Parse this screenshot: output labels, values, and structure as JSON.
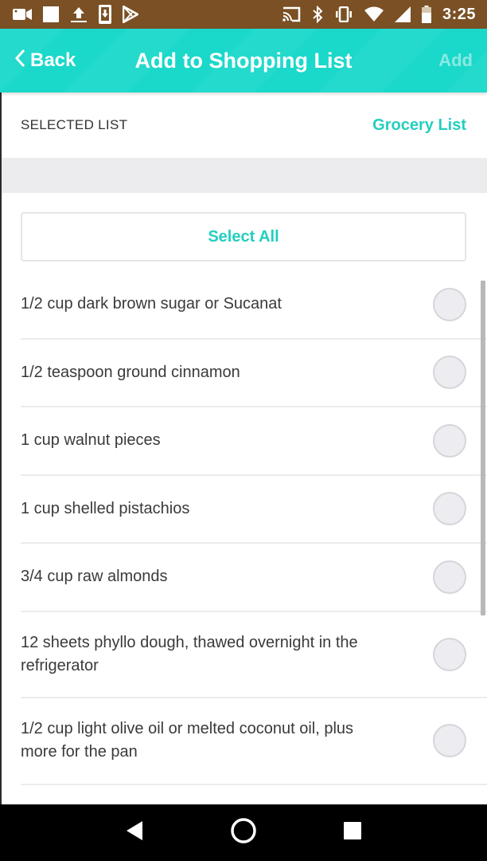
{
  "status_bar": {
    "left_icons": [
      "video-camera-icon",
      "square-notification-icon",
      "upload-icon",
      "download-to-phone-icon",
      "play-store-icon"
    ],
    "right_icons": [
      "cast-icon",
      "bluetooth-icon",
      "vibrate-icon",
      "wifi-icon",
      "cellular-signal-icon",
      "battery-icon"
    ],
    "time": "3:25"
  },
  "app_bar": {
    "back_label": "Back",
    "title": "Add to Shopping List",
    "add_label": "Add",
    "colors": {
      "background": "#1ad8ca",
      "add_disabled": "#8ae9e2"
    }
  },
  "selected_list": {
    "label": "SELECTED LIST",
    "value": "Grocery List"
  },
  "select_all_label": "Select All",
  "accent_color": "#23cfbf",
  "ingredients": [
    {
      "text": "1/2 cup dark brown sugar or Sucanat",
      "checked": false
    },
    {
      "text": "1/2 teaspoon ground cinnamon",
      "checked": false
    },
    {
      "text": "1 cup walnut pieces",
      "checked": false
    },
    {
      "text": "1 cup shelled pistachios",
      "checked": false
    },
    {
      "text": "3/4 cup raw almonds",
      "checked": false
    },
    {
      "text": "12 sheets phyllo dough, thawed overnight in the refrigerator",
      "checked": false
    },
    {
      "text": "1/2 cup light olive oil or melted coconut oil, plus more for the pan",
      "checked": false
    }
  ],
  "nav_bar": {
    "buttons": [
      "back-triangle-icon",
      "home-circle-icon",
      "recents-square-icon"
    ]
  }
}
